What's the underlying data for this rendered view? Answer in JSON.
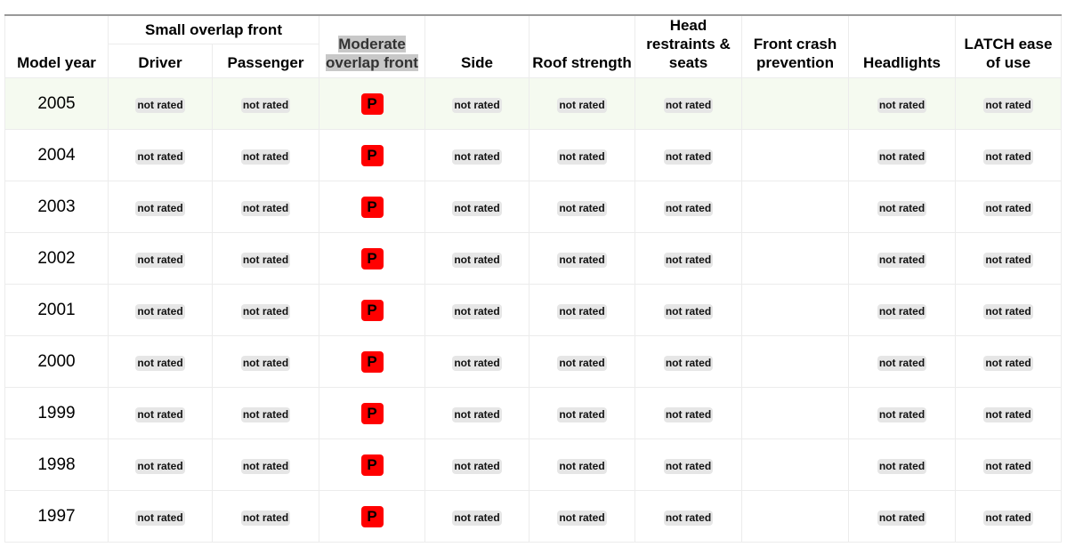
{
  "headers": {
    "model_year": "Model year",
    "small_overlap": "Small overlap front",
    "driver": "Driver",
    "passenger": "Passenger",
    "moderate_overlap": "Moderate overlap front",
    "side": "Side",
    "roof": "Roof strength",
    "head_restraints": "Head restraints & seats",
    "front_crash": "Front crash prevention",
    "headlights": "Headlights",
    "latch": "LATCH ease of use"
  },
  "not_rated": "not rated",
  "rating_colors": {
    "P": "#ff0000"
  },
  "rows": [
    {
      "year": "2005",
      "moderate": "P"
    },
    {
      "year": "2004",
      "moderate": "P"
    },
    {
      "year": "2003",
      "moderate": "P"
    },
    {
      "year": "2002",
      "moderate": "P"
    },
    {
      "year": "2001",
      "moderate": "P"
    },
    {
      "year": "2000",
      "moderate": "P"
    },
    {
      "year": "1999",
      "moderate": "P"
    },
    {
      "year": "1998",
      "moderate": "P"
    },
    {
      "year": "1997",
      "moderate": "P"
    }
  ]
}
